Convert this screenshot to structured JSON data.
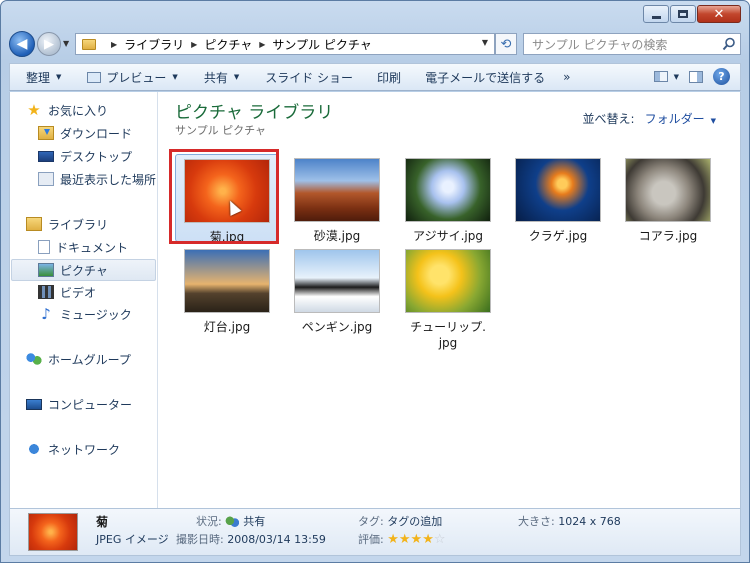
{
  "window": {
    "close_glyph": "✕"
  },
  "nav_buttons": {
    "back": "◀",
    "forward": "▶"
  },
  "address": {
    "crumbs": [
      "ライブラリ",
      "ピクチャ",
      "サンプル ピクチャ"
    ],
    "search_placeholder": "サンプル ピクチャの検索"
  },
  "toolbar": {
    "organize": "整理",
    "preview": "プレビュー",
    "share": "共有",
    "slideshow": "スライド ショー",
    "print": "印刷",
    "email": "電子メールで送信する",
    "more": "»",
    "help": "?"
  },
  "sidebar": {
    "favorites": "お気に入り",
    "downloads": "ダウンロード",
    "desktop": "デスクトップ",
    "recent": "最近表示した場所",
    "libraries": "ライブラリ",
    "documents": "ドキュメント",
    "pictures": "ピクチャ",
    "videos": "ビデオ",
    "music": "ミュージック",
    "homegroup": "ホームグループ",
    "computer": "コンピューター",
    "network": "ネットワーク"
  },
  "main": {
    "title": "ピクチャ ライブラリ",
    "subtitle": "サンプル ピクチャ",
    "arrange_label": "並べ替え:",
    "arrange_value": "フォルダー",
    "files": [
      {
        "name": "菊.jpg",
        "selected": true
      },
      {
        "name": "砂漠.jpg"
      },
      {
        "name": "アジサイ.jpg"
      },
      {
        "name": "クラゲ.jpg"
      },
      {
        "name": "コアラ.jpg"
      },
      {
        "name": "灯台.jpg"
      },
      {
        "name": "ペンギン.jpg"
      },
      {
        "name": "チューリップ.",
        "name2": "jpg"
      }
    ]
  },
  "details": {
    "name": "菊",
    "type": "JPEG イメージ",
    "status_label": "状況:",
    "status_value": "共有",
    "date_label": "撮影日時:",
    "date_value": "2008/03/14 13:59",
    "tag_label": "タグ:",
    "tag_value": "タグの追加",
    "rating_label": "評価:",
    "rating": 4,
    "rating_max": 5,
    "size_label": "大きさ:",
    "size_value": "1024 x 768"
  },
  "colors": {
    "selection_outline": "#d62a2a",
    "library_title": "#1a6b3a"
  }
}
